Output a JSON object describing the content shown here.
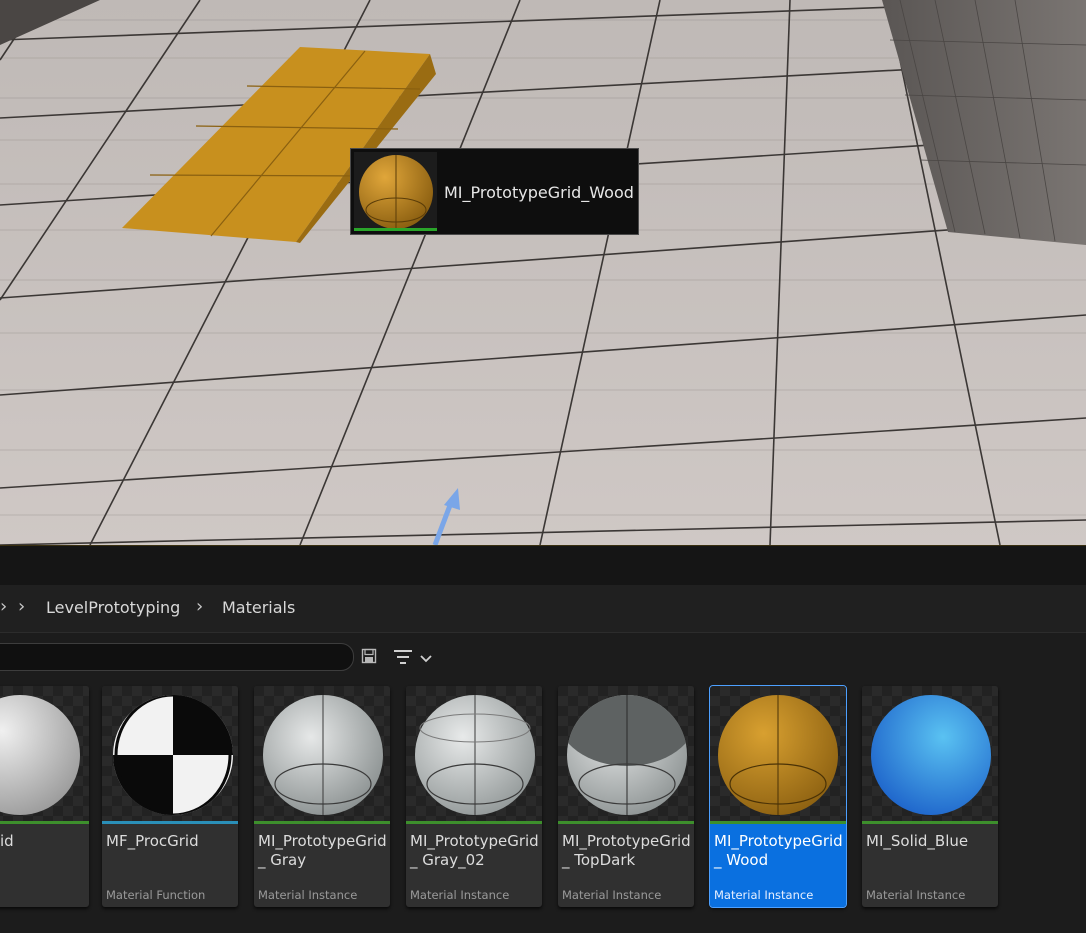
{
  "drag_tooltip": {
    "asset_name": "MI_PrototypeGrid_Wood",
    "thumbnail_icon": "wood-sphere-icon"
  },
  "breadcrumb": {
    "items": [
      {
        "label": "LevelPrototyping"
      },
      {
        "label": "Materials"
      }
    ],
    "separator_icon": "chevron-right-icon"
  },
  "toolbar": {
    "save_icon": "save-icon",
    "filter_icon": "filter-icon",
    "dropdown_icon": "chevron-down-icon"
  },
  "assets": [
    {
      "title": "id",
      "type": "",
      "icon": "gray-sphere-icon"
    },
    {
      "title": "MF_ProcGrid",
      "type": "Material Function",
      "icon": "procgrid-sphere-icon"
    },
    {
      "title": "MI_PrototypeGrid_ Gray",
      "type": "Material Instance",
      "icon": "gray-grid-sphere-icon"
    },
    {
      "title": "MI_PrototypeGrid_ Gray_02",
      "type": "Material Instance",
      "icon": "gray02-grid-sphere-icon"
    },
    {
      "title": "MI_PrototypeGrid_ TopDark",
      "type": "Material Instance",
      "icon": "topdark-grid-sphere-icon"
    },
    {
      "title": "MI_PrototypeGrid_ Wood",
      "type": "Material Instance",
      "icon": "wood-grid-sphere-icon",
      "selected": true
    },
    {
      "title": "MI_Solid_Blue",
      "type": "Material Instance",
      "icon": "blue-sphere-icon"
    }
  ],
  "colors": {
    "selection": "#0a70e0",
    "wood": "#c8901e",
    "floor": "#c9c3c0",
    "solid_blue": "#2a90e0"
  }
}
